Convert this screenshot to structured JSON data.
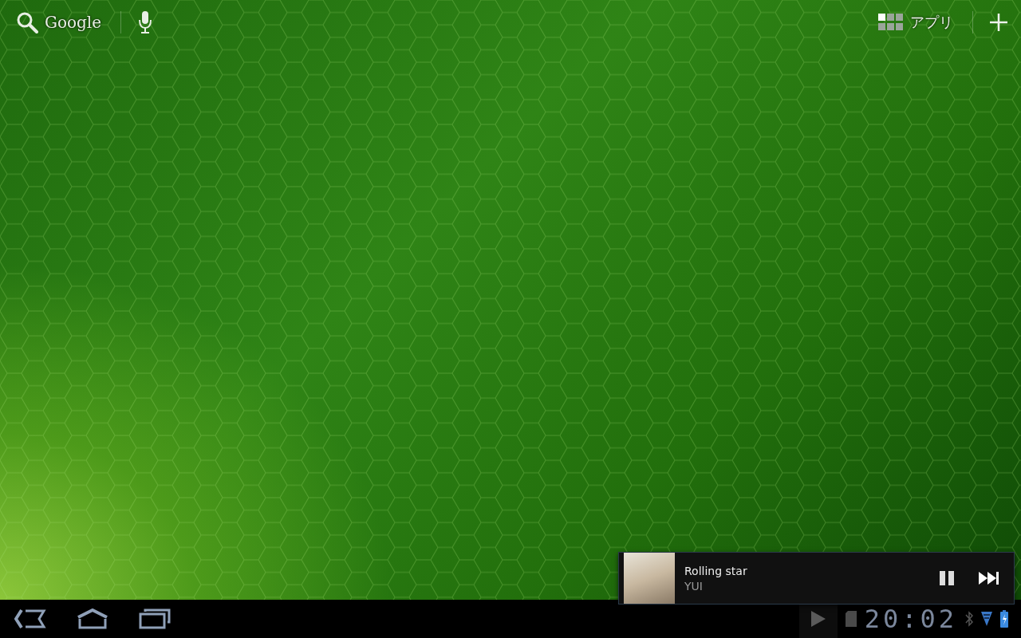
{
  "top_bar": {
    "search_label": "Google",
    "apps_label": "アプリ"
  },
  "notification": {
    "title": "Rolling star",
    "artist": "YUI",
    "playing": true
  },
  "system_bar": {
    "clock": "20:02"
  }
}
